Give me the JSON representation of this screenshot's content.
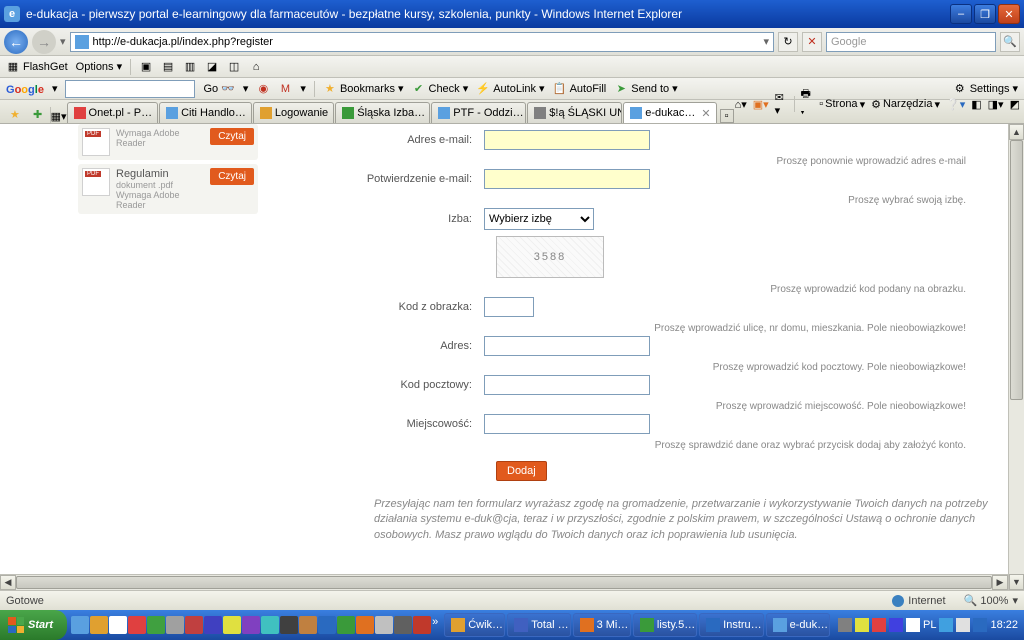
{
  "titlebar": {
    "title": "e-dukacja - pierwszy portal e-learningowy dla farmaceutów - bezpłatne kursy, szkolenia, punkty  - Windows Internet Explorer"
  },
  "address": {
    "url": "http://e-dukacja.pl/index.php?register"
  },
  "search": {
    "placeholder": "Google"
  },
  "flashget": {
    "label": "FlashGet",
    "options": "Options"
  },
  "googlebar": {
    "go": "Go",
    "bookmarks": "Bookmarks",
    "check": "Check",
    "autolink": "AutoLink",
    "autofill": "AutoFill",
    "sendto": "Send to",
    "settings": "Settings"
  },
  "tabs": {
    "items": [
      {
        "label": "Onet.pl - P…"
      },
      {
        "label": "Citi Handlo…"
      },
      {
        "label": "Logowanie"
      },
      {
        "label": "Śląska Izba…"
      },
      {
        "label": "PTF - Oddzi…"
      },
      {
        "label": "$!ą ŚLĄSKI UNI…"
      },
      {
        "label": "e-dukac…"
      }
    ]
  },
  "tabtools": {
    "strona": "Strona",
    "narzedzia": "Narzędzia"
  },
  "sidebar": {
    "items": [
      {
        "title": "",
        "sub1": "Wymaga Adobe Reader",
        "btn": "Czytaj"
      },
      {
        "title": "Regulamin",
        "sub1": "dokument .pdf",
        "sub2": "Wymaga Adobe Reader",
        "btn": "Czytaj"
      }
    ]
  },
  "form": {
    "email_label": "Adres e-mail:",
    "email2_hint": "Proszę ponownie wprowadzić adres e-mail",
    "email2_label": "Potwierdzenie e-mail:",
    "izba_hint": "Proszę wybrać swoją izbę.",
    "izba_label": "Izba:",
    "izba_selected": "Wybierz izbę",
    "captcha_value": "3588",
    "captcha_hint": "Proszę wprowadzić kod podany na obrazku.",
    "captcha_label": "Kod z obrazka:",
    "adres_hint": "Proszę wprowadzić ulicę, nr domu, mieszkania. Pole nieobowiązkowe!",
    "adres_label": "Adres:",
    "kod_hint": "Proszę wprowadzić kod pocztowy. Pole nieobowiązkowe!",
    "kod_label": "Kod pocztowy:",
    "miejsc_hint": "Proszę wprowadzić miejscowość. Pole nieobowiązkowe!",
    "miejsc_label": "Miejscowość:",
    "submit_hint": "Proszę sprawdzić dane oraz wybrać przycisk dodaj aby założyć konto.",
    "submit": "Dodaj",
    "disclaimer": "Przesyłając nam ten formularz wyrażasz zgodę na gromadzenie, przetwarzanie i wykorzystywanie Twoich danych na potrzeby działania systemu e-duk@cja, teraz i w przyszłości, zgodnie z polskim prawem, w szczególności Ustawą o ochronie danych osobowych. Masz prawo wglądu do Twoich danych oraz ich poprawienia lub usunięcia."
  },
  "status": {
    "ready": "Gotowe",
    "zone": "Internet",
    "zoom": "🔍 100%"
  },
  "taskbar": {
    "start": "Start",
    "tasks": [
      {
        "label": "Ćwik…"
      },
      {
        "label": "Total …"
      },
      {
        "label": "3 Mi…"
      },
      {
        "label": "listy.5…"
      },
      {
        "label": "Instru…"
      },
      {
        "label": "e-duk…"
      }
    ],
    "lang": "PL",
    "time": "18:22"
  }
}
